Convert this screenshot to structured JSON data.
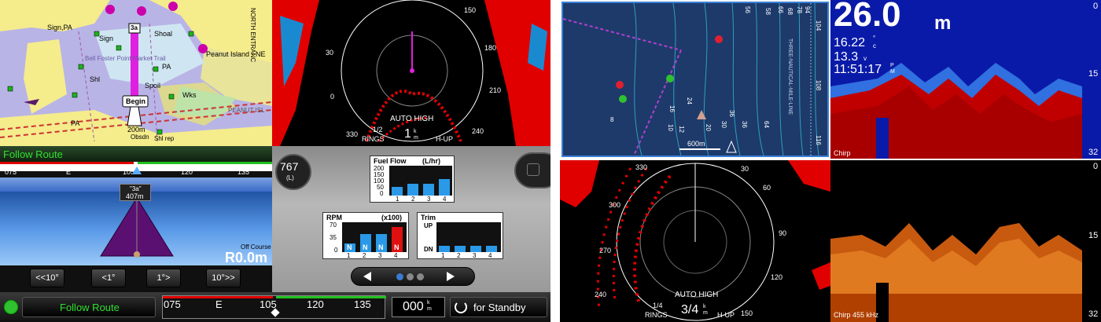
{
  "screen1": {
    "chart_plotter": {
      "labels": [
        "Sign,PA",
        "Sign",
        "Shoal",
        "Peanut Island - NE",
        "Shl",
        "Spoil",
        "PA",
        "Wks",
        "PA",
        "200m",
        "Obsdn",
        "Shl rep",
        "PEANUT ISL",
        "Begin",
        "Bell Foster Point Market Trail",
        "N",
        "NORTH ENTRANC"
      ],
      "waypoint_tag": "3a"
    },
    "radar_top": {
      "mode": "AUTO HIGH",
      "rings_label": "1/2",
      "rings_word": "RINGS",
      "range": "1",
      "range_unit_top": "k",
      "range_unit_bottom": "m",
      "orientation": "H-UP",
      "bearings": [
        "150",
        "180",
        "210",
        "240",
        "330",
        "30",
        "0"
      ]
    },
    "follow_route": {
      "title": "Follow Route",
      "compass_ticks": [
        "075",
        "E",
        "105",
        "120",
        "135"
      ],
      "waypoint_name": "\"3a\"",
      "waypoint_dist": "407m",
      "off_course_label": "Off Course",
      "off_course_value": "R0.0m",
      "buttons": [
        "<<10°",
        "<1°",
        "1°>",
        "10°>>"
      ]
    },
    "gauges": {
      "left_value": "767",
      "left_unit": "(L)",
      "fuel_flow": {
        "title": "Fuel Flow",
        "unit": "(L/hr)",
        "scale": [
          "200",
          "150",
          "100",
          "50",
          "0"
        ],
        "engines": [
          "1",
          "2",
          "3",
          "4"
        ],
        "levels": [
          0.3,
          0.4,
          0.4,
          0.55
        ]
      },
      "rpm": {
        "title": "RPM",
        "unit": "(x100)",
        "scale": [
          "70",
          "35",
          "0"
        ],
        "engines": [
          "1",
          "2",
          "3",
          "4"
        ],
        "markers": [
          "N",
          "N",
          "N",
          "N"
        ],
        "levels": [
          0.3,
          0.6,
          0.6,
          0.85
        ]
      },
      "trim": {
        "title": "Trim",
        "up": "UP",
        "dn": "DN",
        "engines": [
          "1",
          "2",
          "3",
          "4"
        ],
        "levels": [
          0.2,
          0.2,
          0.2,
          0.2
        ]
      }
    },
    "bottom_bar": {
      "follow_route": "Follow Route",
      "compass_ticks": [
        "075",
        "E",
        "105",
        "120",
        "135"
      ],
      "speed": "000",
      "speed_unit_top": "k",
      "speed_unit_bottom": "m",
      "standby": "for Standby"
    }
  },
  "screen2": {
    "depth_chart": {
      "contours": [
        "56",
        "58",
        "66",
        "68",
        "78",
        "94",
        "104",
        "108",
        "116",
        "16",
        "24",
        "12",
        "10",
        "64",
        "36",
        "8",
        "20",
        "30",
        "36"
      ],
      "line_label": "THREE-NAUTICAL-MILE-LINE",
      "scale": "600m"
    },
    "sonar_top": {
      "depth": "26.0",
      "depth_unit": "m",
      "temp": "16.22",
      "temp_unit_top": "°",
      "temp_unit_bottom": "c",
      "voltage": "13.3",
      "voltage_unit": "v",
      "time": "11:51:17",
      "time_unit_top": "P",
      "time_unit_bottom": "M",
      "scale": [
        "0",
        "15",
        "32"
      ],
      "freq": "Chirp"
    },
    "radar_bottom": {
      "mode": "AUTO HIGH",
      "rings_label": "1/4",
      "rings_word": "RINGS",
      "range": "3/4",
      "range_unit_top": "k",
      "range_unit_bottom": "m",
      "orientation": "H-UP",
      "bearings": [
        "330",
        "30",
        "60",
        "90",
        "120",
        "150",
        "240",
        "270",
        "300"
      ]
    },
    "sonar_bottom": {
      "scale": [
        "0",
        "15",
        "32"
      ],
      "freq": "Chirp 455 kHz"
    }
  }
}
